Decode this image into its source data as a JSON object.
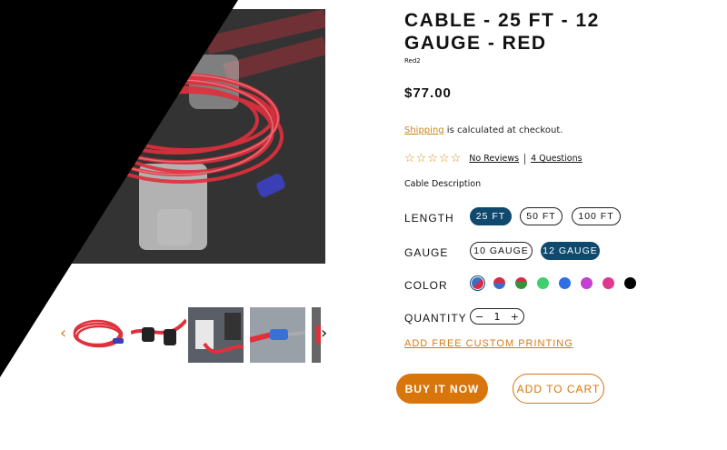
{
  "product": {
    "title": "CABLE - 25 FT - 12 GAUGE - RED",
    "sku": "Red2",
    "price": "$77.00",
    "shipping_link": "Shipping",
    "shipping_text": " is calculated at checkout.",
    "stars": "☆☆☆☆☆",
    "reviews_label": "No Reviews",
    "questions_label": "4 Questions",
    "description": "Cable Description"
  },
  "options": {
    "length": {
      "label": "LENGTH",
      "values": [
        "25 FT",
        "50 FT",
        "100 FT"
      ],
      "selected": "25 FT"
    },
    "gauge": {
      "label": "GAUGE",
      "values": [
        "10 GAUGE",
        "12 GAUGE"
      ],
      "selected": "12 GAUGE"
    },
    "color": {
      "label": "COLOR",
      "swatches": [
        "#d92a4a",
        "#3a6fc4",
        "#3a8f3a",
        "#3fcf6e",
        "#2f6fe6",
        "#c53fd0",
        "#e0388e",
        "#000000"
      ]
    },
    "quantity": {
      "label": "QUANTITY",
      "minus": "−",
      "value": "1",
      "plus": "+"
    }
  },
  "links": {
    "custom_printing": "ADD FREE CUSTOM PRINTING"
  },
  "buttons": {
    "buy_now": "BUY IT NOW",
    "add_to_cart": "ADD TO CART"
  },
  "gallery": {
    "prev": "‹",
    "next": "›"
  },
  "colors": {
    "accent": "#d8750b",
    "selected": "#0f4a6e",
    "cable": "#e0303c"
  }
}
